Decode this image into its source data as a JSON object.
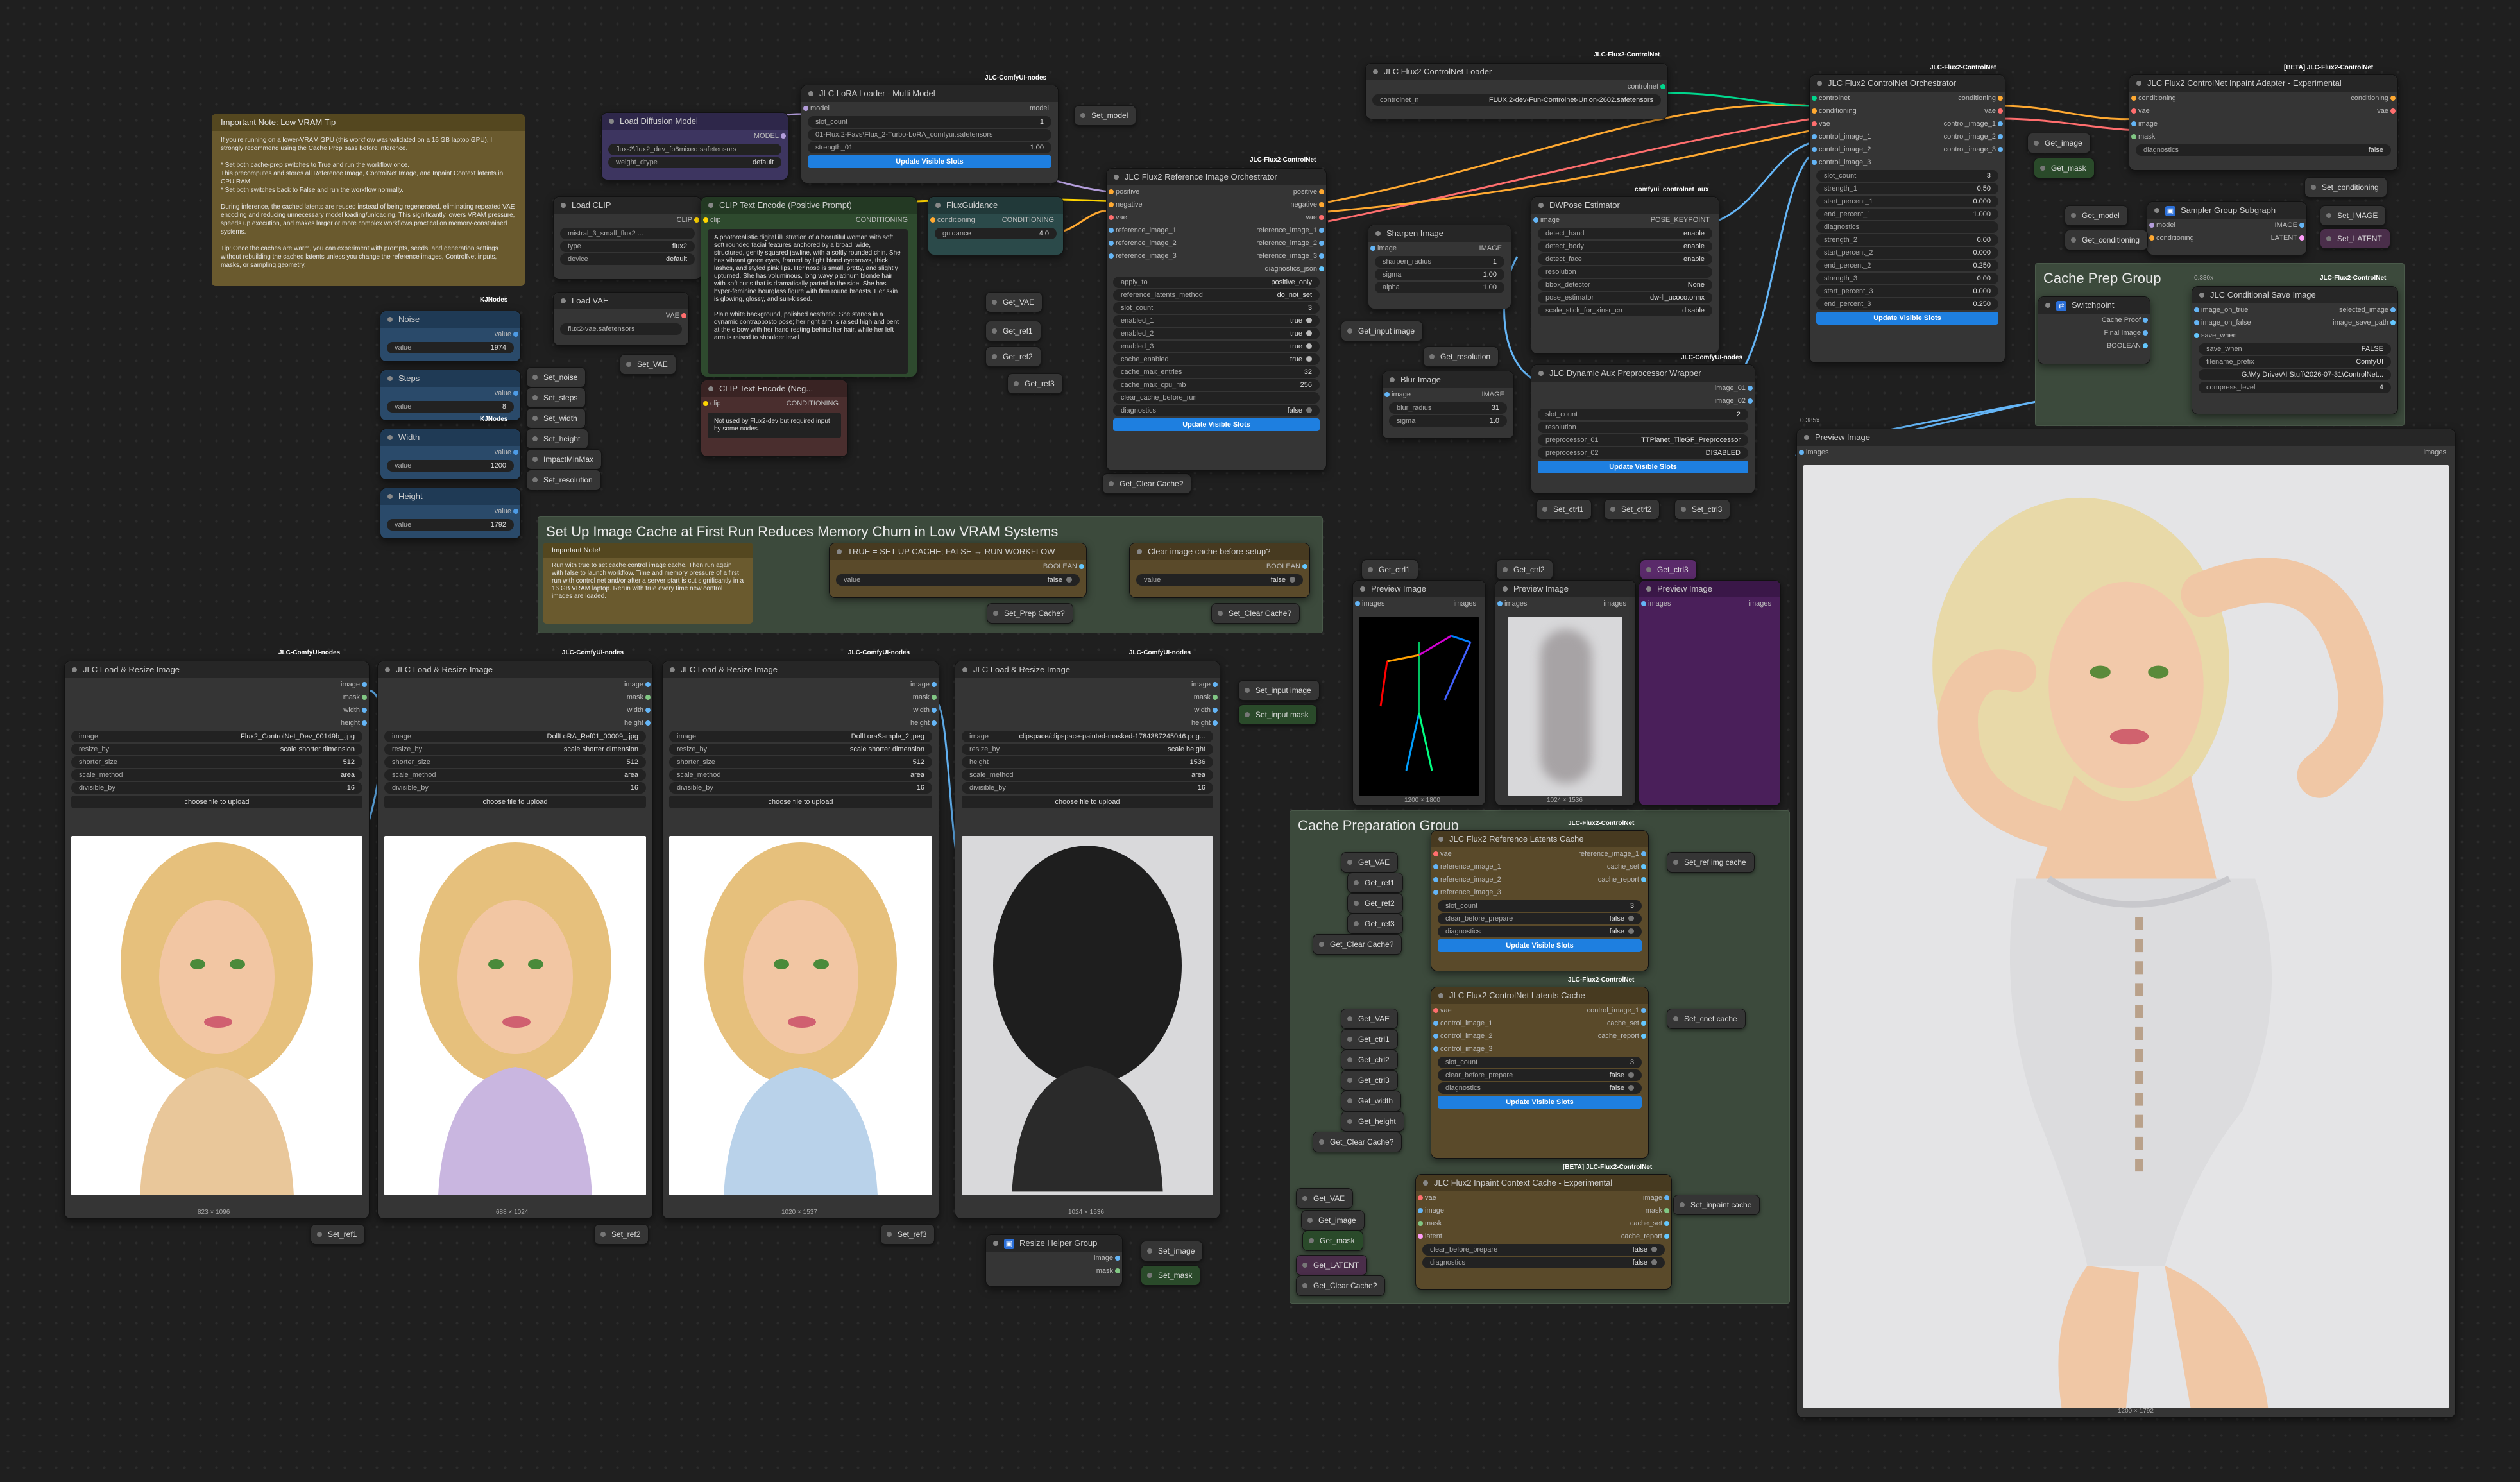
{
  "groups": {
    "low_vram": "Set Up Image Cache at First Run Reduces Memory Churn in Low VRAM Systems",
    "cache_prep": "Cache Prep Group",
    "cache_preparation": "Cache Preparation Group",
    "resize_helper": "Resize Helper Group",
    "sampler": "Sampler Group Subgraph"
  },
  "badges": {
    "jlc": "JLC-ComfyUI-nodes",
    "flux2": "JLC-Flux2-ControlNet",
    "kj": "KJNodes",
    "aux": "comfyui_controlnet_aux",
    "beta": "[BETA] JLC-Flux2-ControlNet"
  },
  "notes": {
    "important_title": "Important Note: Low VRAM Tip",
    "important_text": "If you're running on a lower-VRAM GPU (this workflow was validated on a 16 GB laptop GPU), I strongly recommend using the Cache Prep pass before inference.\n\n* Set both cache-prep switches to True and run the workflow once.\nThis precomputes and stores all Reference Image, ControlNet Image, and Inpaint Context latents in CPU RAM.\n* Set both switches back to False and run the workflow normally.\n\nDuring inference, the cached latents are reused instead of being regenerated, eliminating repeated VAE encoding and reducing unnecessary model loading/unloading. This significantly lowers VRAM pressure, speeds up execution, and makes larger or more complex workflows practical on memory-constrained systems.\n\nTip: Once the caches are warm, you can experiment with prompts, seeds, and generation settings without rebuilding the cached latents unless you change the reference images, ControlNet inputs, masks, or sampling geometry.\n\nLook for the nodes with yellow frame in this workflow",
    "setup_title": "Important Note!",
    "setup_text": "Run with true to set cache control image cache. Then run again with false to launch workflow. Time and memory pressure of a first run with control net and/or after a server start is cut significantly in a 16 GB VRAM laptop. Rerun with true every time new control images are loaded."
  },
  "nodes": {
    "load_diffusion": {
      "title": "Load Diffusion Model",
      "out": "MODEL",
      "unet": "flux-2\\flux2_dev_fp8mixed.safetensors",
      "dtype_label": "weight_dtype",
      "dtype": "default"
    },
    "lora": {
      "title": "JLC LoRA Loader - Multi Model",
      "in": "model",
      "out": "model",
      "slot_label": "slot_count",
      "slot": "1",
      "lora": "01-Flux.2-Favs\\Flux_2-Turbo-LoRA_comfyui.safetensors",
      "str_label": "strength_01",
      "str": "1.00",
      "btn": "Update Visible Slots"
    },
    "load_clip": {
      "title": "Load CLIP",
      "out": "CLIP",
      "clip": "mistral_3_small_flux2 ...",
      "type_label": "type",
      "type": "flux2",
      "device_label": "device",
      "device": "default"
    },
    "load_vae": {
      "title": "Load VAE",
      "out": "VAE",
      "vae": "flux2-vae.safetensors"
    },
    "pos_prompt": {
      "title": "CLIP Text Encode (Positive Prompt)",
      "in": "clip",
      "out": "CONDITIONING",
      "text": "A photorealistic digital illustration of a beautiful woman with soft, soft rounded facial features anchored by a broad, wide, structured, gently squared jawline, with a softly rounded chin. She has vibrant green eyes, framed by light blond eyebrows, thick lashes, and styled pink lips. Her nose is small, pretty, and slightly upturned. She has voluminous, long wavy platinum blonde hair with soft curls that is dramatically parted to the side. She has hyper-feminine hourglass figure with firm round breasts. Her skin is glowing, glossy, and sun-kissed.\n\nPlain white background, polished aesthetic. She stands in a dynamic contrapposto pose; her right arm is raised high and bent at the elbow with her hand resting behind her hair, while her left arm is raised to shoulder level"
    },
    "neg_prompt": {
      "title": "CLIP Text Encode (Neg...",
      "in": "clip",
      "out": "CONDITIONING",
      "text": "Not used by Flux2-dev but required input by some nodes."
    },
    "flux_guidance": {
      "title": "FluxGuidance",
      "in": "conditioning",
      "out": "CONDITIONING",
      "g_label": "guidance",
      "g": "4.0"
    },
    "noise": {
      "title": "Noise",
      "label": "value",
      "val": "1974",
      "out": "value"
    },
    "steps": {
      "title": "Steps",
      "label": "value",
      "val": "8",
      "out": "value"
    },
    "width": {
      "title": "Width",
      "label": "value",
      "val": "1200",
      "out": "value"
    },
    "height": {
      "title": "Height",
      "label": "value",
      "val": "1792",
      "out": "value"
    },
    "orchestrator": {
      "title": "JLC Flux2 Reference Image Orchestrator",
      "ins": [
        "positive",
        "negative",
        "vae",
        "reference_image_1",
        "reference_image_2",
        "reference_image_3"
      ],
      "outs": [
        "positive",
        "negative",
        "vae",
        "reference_image_1",
        "reference_image_2",
        "reference_image_3",
        "diagnostics_json"
      ],
      "widgets": [
        [
          "apply_to",
          "positive_only"
        ],
        [
          "reference_latents_method",
          "do_not_set"
        ],
        [
          "slot_count",
          "3"
        ],
        [
          "enabled_1",
          "true"
        ],
        [
          "enabled_2",
          "true"
        ],
        [
          "enabled_3",
          "true"
        ],
        [
          "cache_enabled",
          "true"
        ],
        [
          "cache_max_entries",
          "32"
        ],
        [
          "cache_max_cpu_mb",
          "256"
        ],
        [
          "clear_cache_before_run",
          ""
        ],
        [
          "diagnostics",
          "false"
        ]
      ],
      "btn": "Update Visible Slots"
    },
    "cn_loader": {
      "title": "JLC Flux2 ControlNet Loader",
      "out": "controlnet",
      "cn": "controlnet_n",
      "file": "FLUX.2-dev-Fun-Controlnet-Union-2602.safetensors"
    },
    "sharpen": {
      "title": "Sharpen Image",
      "in": "image",
      "out": "IMAGE",
      "widgets": [
        [
          "sharpen_radius",
          "1"
        ],
        [
          "sigma",
          "1.00"
        ],
        [
          "alpha",
          "1.00"
        ]
      ]
    },
    "dwpose": {
      "title": "DWPose Estimator",
      "in": "image",
      "out": "POSE_KEYPOINT",
      "widgets": [
        [
          "detect_hand",
          "enable"
        ],
        [
          "detect_body",
          "enable"
        ],
        [
          "detect_face",
          "enable"
        ],
        [
          "resolution",
          ""
        ],
        [
          "bbox_detector",
          "None"
        ],
        [
          "pose_estimator",
          "dw-ll_ucoco.onnx"
        ],
        [
          "scale_stick_for_xinsr_cn",
          "disable"
        ]
      ]
    },
    "blur": {
      "title": "Blur Image",
      "in": "image",
      "out": "IMAGE",
      "widgets": [
        [
          "blur_radius",
          "31"
        ],
        [
          "sigma",
          "1.0"
        ]
      ]
    },
    "dyn_aux": {
      "title": "JLC Dynamic Aux Preprocessor Wrapper",
      "outs": [
        "image_01",
        "image_02"
      ],
      "widgets": [
        [
          "slot_count",
          "2"
        ],
        [
          "resolution",
          ""
        ],
        [
          "preprocessor_01",
          "TTPlanet_TileGF_Preprocessor"
        ],
        [
          "preprocessor_02",
          "DISABLED"
        ]
      ],
      "btn": "Update Visible Slots"
    },
    "cn_orch": {
      "title": "JLC Flux2 ControlNet Orchestrator",
      "ins": [
        "controlnet",
        "conditioning",
        "vae",
        "control_image_1",
        "control_image_2",
        "control_image_3"
      ],
      "outs": [
        "conditioning",
        "vae",
        "control_image_1",
        "control_image_2",
        "control_image_3"
      ],
      "widgets": [
        [
          "slot_count",
          "3"
        ],
        [
          "strength_1",
          "0.50"
        ],
        [
          "start_percent_1",
          "0.000"
        ],
        [
          "end_percent_1",
          "1.000"
        ],
        [
          "diagnostics",
          ""
        ],
        [
          "strength_2",
          "0.00"
        ],
        [
          "start_percent_2",
          "0.000"
        ],
        [
          "end_percent_2",
          "0.250"
        ],
        [
          "strength_3",
          "0.00"
        ],
        [
          "start_percent_3",
          "0.000"
        ],
        [
          "end_percent_3",
          "0.250"
        ]
      ],
      "btn": "Update Visible Slots"
    },
    "inpaint_adapter": {
      "title": "JLC Flux2 ControlNet Inpaint Adapter - Experimental",
      "ins": [
        "conditioning",
        "vae",
        "image",
        "mask"
      ],
      "outs": [
        "conditioning",
        "vae"
      ],
      "diag_label": "diagnostics",
      "diag": "false"
    },
    "cache_save": {
      "title": "JLC Conditional Save Image",
      "ins": [
        "image_on_true",
        "image_on_false",
        "save_when"
      ],
      "outs": [
        "selected_image",
        "image_save_path"
      ],
      "widgets": [
        [
          "save_when",
          "FALSE"
        ],
        [
          "filename_prefix",
          "ComfyUI"
        ],
        [
          "",
          "G:\\My Drive\\AI Stuff\\2026-07-31\\ControlNet..."
        ],
        [
          "compress_level",
          "4"
        ]
      ]
    },
    "switchpoint": {
      "title": "Switchpoint",
      "outs": [
        "Cache Proof",
        "Final Image",
        "BOOLEAN"
      ]
    },
    "preview_main": {
      "title": "Preview Image",
      "in": "images",
      "out": "images",
      "dims": "1200 × 1792",
      "zoom": "0.385x"
    },
    "prev_ctrl1": {
      "title": "Preview Image",
      "in": "images",
      "out": "images",
      "dims": "1200 × 1800"
    },
    "prev_ctrl2": {
      "title": "Preview Image",
      "in": "images",
      "out": "images",
      "dims": "1024 × 1536"
    },
    "prev_ctrl3": {
      "title": "Preview Image",
      "in": "images",
      "out": "images"
    },
    "setup_bool": {
      "title": "TRUE = SET UP CACHE; FALSE → RUN WORKFLOW",
      "out": "BOOLEAN",
      "label": "value",
      "val": "false"
    },
    "clear_bool": {
      "title": "Clear image cache before setup?",
      "out": "BOOLEAN",
      "label": "value",
      "val": "false"
    },
    "ref_cache": {
      "title": "JLC Flux2 Reference Latents Cache",
      "ins": [
        "vae",
        "reference_image_1",
        "reference_image_2",
        "reference_image_3"
      ],
      "outs": [
        "reference_image_1",
        "cache_set",
        "cache_report"
      ],
      "widgets": [
        [
          "slot_count",
          "3"
        ],
        [
          "clear_before_prepare",
          "false"
        ],
        [
          "diagnostics",
          "false"
        ]
      ],
      "btn": "Update Visible Slots"
    },
    "cn_cache": {
      "title": "JLC Flux2 ControlNet Latents Cache",
      "ins": [
        "vae",
        "control_image_1",
        "control_image_2",
        "control_image_3"
      ],
      "outs": [
        "control_image_1",
        "cache_set",
        "cache_report"
      ],
      "widgets": [
        [
          "slot_count",
          "3"
        ],
        [
          "clear_before_prepare",
          "false"
        ],
        [
          "diagnostics",
          "false"
        ]
      ],
      "btn": "Update Visible Slots"
    },
    "inpaint_cache": {
      "title": "JLC Flux2 Inpaint Context Cache - Experimental",
      "ins": [
        "vae",
        "image",
        "mask",
        "latent"
      ],
      "outs": [
        "image",
        "mask",
        "cache_set",
        "cache_report"
      ],
      "widgets": [
        [
          "clear_before_prepare",
          "false"
        ],
        [
          "diagnostics",
          "false"
        ]
      ]
    },
    "resize_helper": {
      "outs": [
        "image",
        "mask"
      ]
    },
    "sampler": {
      "ins": [
        "model",
        "conditioning"
      ],
      "outs": [
        "IMAGE",
        "LATENT"
      ]
    }
  },
  "loaders": [
    {
      "title": "JLC Load & Resize Image",
      "outs": [
        "image",
        "mask",
        "width",
        "height"
      ],
      "image": "Flux2_ControlNet_Dev_00149b_.jpg",
      "resize_by": "scale shorter dimension",
      "shorter_size": "512",
      "scale_method": "area",
      "divisible_by": "16",
      "btn": "choose file to upload",
      "dims": "823 × 1096",
      "set": "Set_ref1"
    },
    {
      "title": "JLC Load & Resize Image",
      "outs": [
        "image",
        "mask",
        "width",
        "height"
      ],
      "image": "DollLoRA_Ref01_00009_.jpg",
      "resize_by": "scale shorter dimension",
      "shorter_size": "512",
      "scale_method": "area",
      "divisible_by": "16",
      "btn": "choose file to upload",
      "dims": "688 × 1024",
      "set": "Set_ref2"
    },
    {
      "title": "JLC Load & Resize Image",
      "outs": [
        "image",
        "mask",
        "width",
        "height"
      ],
      "image": "DollLoraSample_2.jpeg",
      "resize_by": "scale shorter dimension",
      "shorter_size": "512",
      "scale_method": "area",
      "divisible_by": "16",
      "btn": "choose file to upload",
      "dims": "1020 × 1537",
      "set": "Set_ref3"
    },
    {
      "title": "JLC Load & Resize Image",
      "outs": [
        "image",
        "mask",
        "width",
        "height"
      ],
      "image": "clipspace/clipspace-painted-masked-1784387245046.png...",
      "resize_by": "scale height",
      "shorter_size": "1536",
      "scale_method": "area",
      "divisible_by": "16",
      "btn": "choose file to upload",
      "dims": "1024 × 1536",
      "set": ""
    }
  ],
  "widget_labels": {
    "image": "image",
    "resize_by": "resize_by",
    "shorter_size": "shorter_size",
    "height": "height",
    "scale_method": "scale_method",
    "divisible_by": "divisible_by"
  },
  "chips": {
    "set_model": "Set_model",
    "set_noise": "Set_noise",
    "set_steps": "Set_steps",
    "set_width": "Set_width",
    "set_height": "Set_height",
    "impact_min_max": "ImpactMinMax",
    "set_resolution": "Set_resolution",
    "set_vae": "Set_VAE",
    "get_vae_a": "Get_VAE",
    "get_ref1_a": "Get_ref1",
    "get_ref2_a": "Get_ref2",
    "get_ref3_a": "Get_ref3",
    "get_clear_cache_a": "Get_Clear Cache?",
    "get_input_image": "Get_input image",
    "get_resolution": "Get_resolution",
    "set_ctrl1": "Set_ctrl1",
    "set_ctrl2": "Set_ctrl2",
    "set_ctrl3": "Set_ctrl3",
    "get_ctrl1": "Get_ctrl1",
    "get_ctrl2": "Get_ctrl2",
    "get_ctrl3": "Get_ctrl3",
    "set_prep_cache": "Set_Prep Cache?",
    "set_clear_cache": "Set_Clear Cache?",
    "set_input_image": "Set_input image",
    "set_input_mask": "Set_input mask",
    "get_image_top": "Get_image",
    "get_mask_top": "Get_mask",
    "set_conditioning": "Set_conditioning",
    "get_model": "Get_model",
    "get_conditioning": "Get_conditioning",
    "set_image": "Set_IMAGE",
    "set_latent": "Set_LATENT",
    "get_vae_b": "Get_VAE",
    "get_ref1_b": "Get_ref1",
    "get_ref2_b": "Get_ref2",
    "get_ref3_b": "Get_ref3",
    "get_clear_cache_b": "Get_Clear Cache?",
    "set_ref_img_cache": "Set_ref img cache",
    "get_vae_c": "Get_VAE",
    "get_ctrl1_c": "Get_ctrl1",
    "get_ctrl2_c": "Get_ctrl2",
    "get_ctrl3_c": "Get_ctrl3",
    "get_width": "Get_width",
    "get_height": "Get_height",
    "get_clear_cache_c": "Get_Clear Cache?",
    "set_cnet_cache": "Set_cnet cache",
    "get_vae_d": "Get_VAE",
    "get_image_d": "Get_image",
    "get_mask_d": "Get_mask",
    "get_latent_d": "Get_LATENT",
    "get_clear_cache_d": "Get_Clear Cache?",
    "set_inpaint_cache": "Set_inpaint cache",
    "set_image_helper": "Set_image",
    "set_mask_helper": "Set_mask",
    "set_ref1": "Set_ref1",
    "set_ref2": "Set_ref2",
    "set_ref3": "Set_ref3",
    "get_clear_cache_orch": "Get_Clear Cache?",
    "get_ctrl3_purple": "Get_ctrl3"
  },
  "colors": {
    "clip": "#ffd500",
    "model": "#b39ddb",
    "vae": "#ff6e6e",
    "image": "#64b5f6",
    "conditioning": "#ffa931",
    "int": "#4d9be6",
    "mask": "#81c784",
    "latent": "#ff9cf9",
    "boolean": "#64c8ff",
    "cn": "#00d78d"
  }
}
